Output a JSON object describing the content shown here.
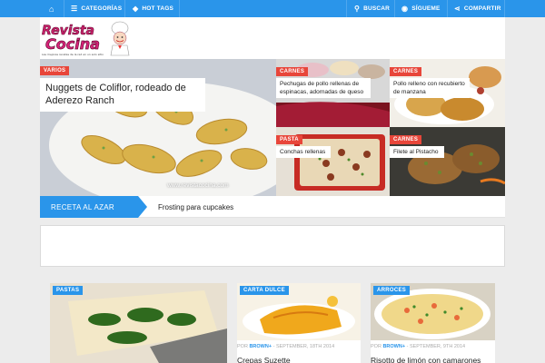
{
  "topbar": {
    "home_icon": "home-icon",
    "categories": "CATEGORÍAS",
    "hot_tags": "HOT TAGS",
    "search": "BUSCAR",
    "follow": "SÍGUEME",
    "share": "COMPARTIR",
    "color": "#2a95ea"
  },
  "logo": {
    "line1": "Revista",
    "line2": "Cocina",
    "tagline": "Las mejores recetas de la red en un solo sitio"
  },
  "hero": {
    "main": {
      "category": "VARIOS",
      "title": "Nuggets de Coliflor, rodeado de Aderezo Ranch",
      "watermark": "www.revistacocina.com"
    },
    "tiles": [
      {
        "category": "CARNES",
        "title": "Pechugas de pollo rellenas de espinacas, adornadas de queso"
      },
      {
        "category": "CARNES",
        "title": "Pollo relleno con recubierto de manzana"
      },
      {
        "category": "PASTA",
        "title": "Conchas rellenas"
      },
      {
        "category": "CARNES",
        "title": "Filete al Pistacho"
      }
    ]
  },
  "random": {
    "label": "RECETA AL AZAR",
    "title": "Frosting para cupcakes"
  },
  "cards": [
    {
      "category": "PASTAS",
      "author_prefix": "",
      "author": "",
      "date": "",
      "title": ""
    },
    {
      "category": "CARTA DULCE",
      "author_prefix": "POR",
      "author": "BROWN+",
      "date": "- SEPTEMBER, 18TH 2014",
      "title": "Crepas Suzette"
    },
    {
      "category": "ARROCES",
      "author_prefix": "POR",
      "author": "BROWN+",
      "date": "- SEPTEMBER, 9TH 2014",
      "title": "Risotto de limón con camarones"
    }
  ],
  "colors": {
    "accent": "#2a95ea",
    "category_red": "#e8463a"
  }
}
